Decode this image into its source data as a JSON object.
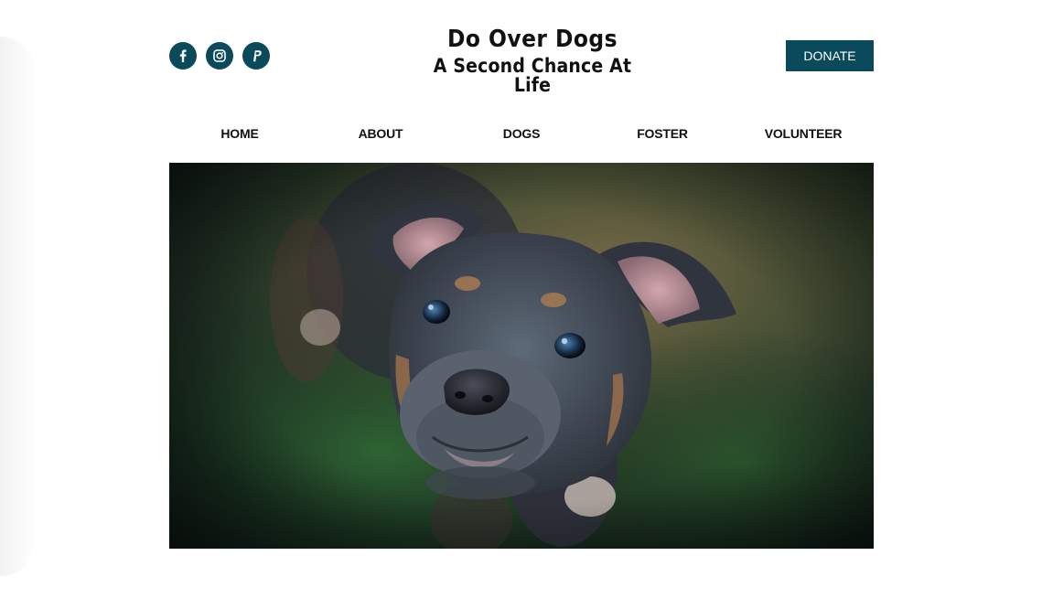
{
  "header": {
    "logo_title": "Do Over Dogs",
    "logo_subtitle": "A Second Chance At Life",
    "donate_label": "DONATE",
    "social": [
      {
        "icon": "facebook-icon"
      },
      {
        "icon": "instagram-icon"
      },
      {
        "icon": "paypal-icon"
      }
    ]
  },
  "nav": {
    "items": [
      {
        "label": "HOME"
      },
      {
        "label": "ABOUT"
      },
      {
        "label": "DOGS"
      },
      {
        "label": "FOSTER"
      },
      {
        "label": "VOLUNTEER"
      }
    ]
  },
  "hero": {
    "image": "puppy-photo"
  },
  "colors": {
    "brand": "#0b4a5a",
    "text": "#111111",
    "background": "#ffffff"
  }
}
